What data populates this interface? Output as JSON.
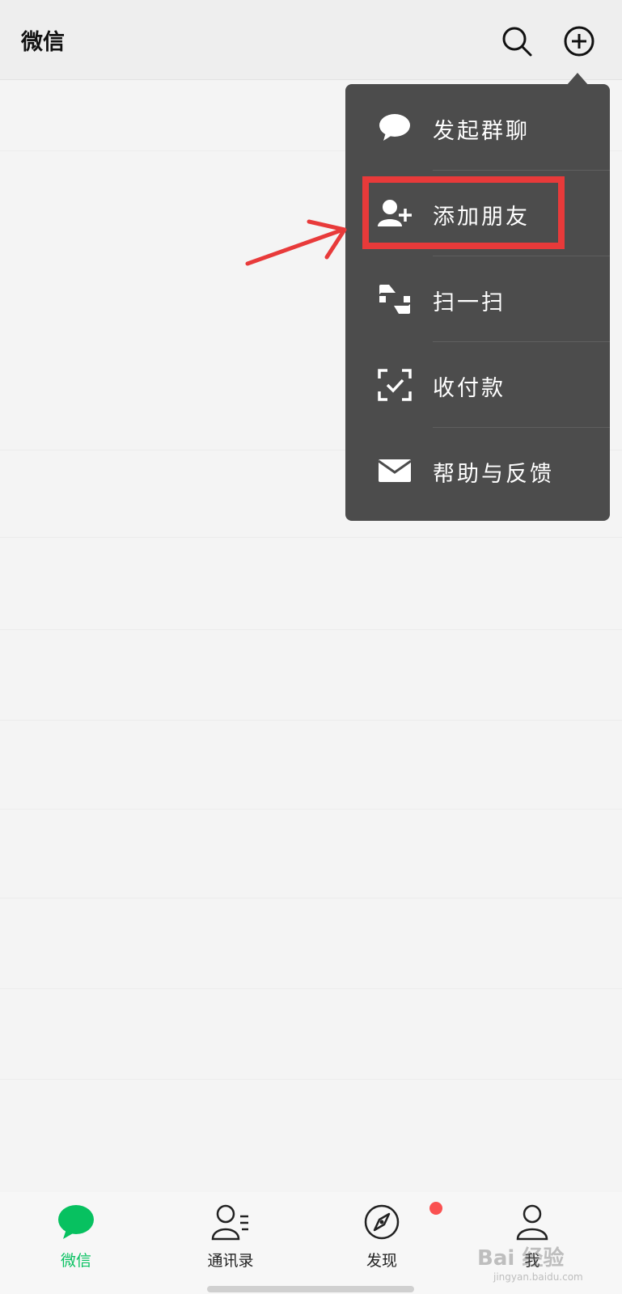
{
  "header": {
    "title": "微信",
    "search_icon": "search-icon",
    "add_icon": "plus-circle-icon"
  },
  "menu": {
    "items": [
      {
        "label": "发起群聊",
        "icon": "chat-bubble-icon"
      },
      {
        "label": "添加朋友",
        "icon": "add-friend-icon"
      },
      {
        "label": "扫一扫",
        "icon": "scan-icon"
      },
      {
        "label": "收付款",
        "icon": "payment-icon"
      },
      {
        "label": "帮助与反馈",
        "icon": "mail-icon"
      }
    ]
  },
  "annotation": {
    "highlight_color": "#e83a3a",
    "highlighted_item": "添加朋友"
  },
  "tabs": [
    {
      "label": "微信",
      "icon": "chat-bubble-icon",
      "active": true
    },
    {
      "label": "通讯录",
      "icon": "contacts-icon",
      "active": false
    },
    {
      "label": "发现",
      "icon": "compass-icon",
      "active": false,
      "badge": "red-dot"
    },
    {
      "label": "我",
      "icon": "person-icon",
      "active": false
    }
  ],
  "watermark": {
    "brand": "Bai 经验",
    "url": "jingyan.baidu.com"
  },
  "colors": {
    "accent": "#07c160",
    "menu_bg": "#4c4c4c",
    "badge": "#fa5151"
  }
}
